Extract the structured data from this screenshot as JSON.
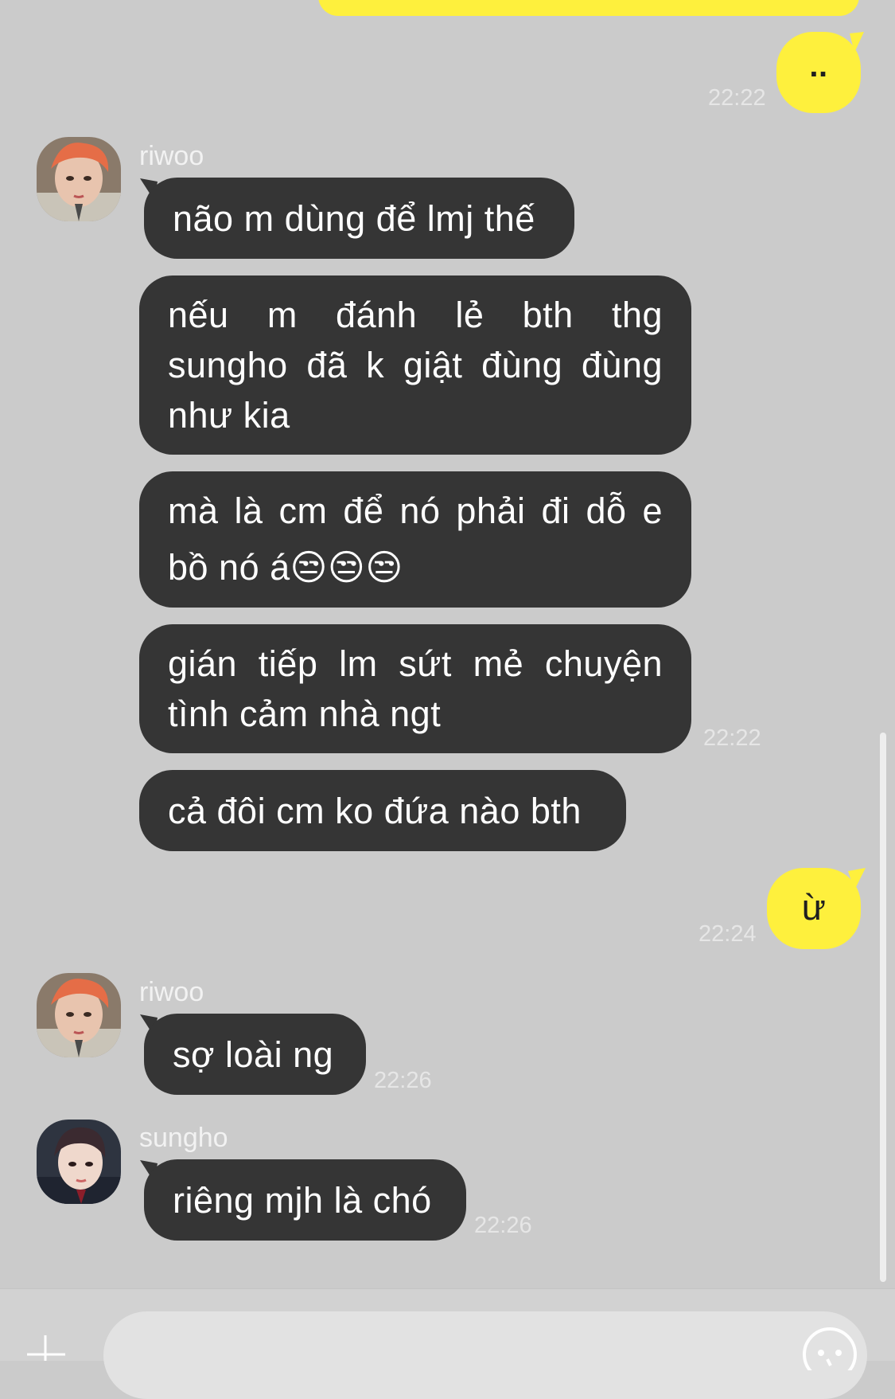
{
  "messages": {
    "m1_text": "..",
    "m1_time": "22:22",
    "group1_sender": "riwoo",
    "g1_b1": "não m dùng để lmj thế",
    "g1_b2_l1": "nếu m đánh lẻ bth thg",
    "g1_b2_l2": "sungho đã k giật đùng đùng",
    "g1_b2_l3": "như kia",
    "g1_b3_l1": "mà là cm để nó phải đi dỗ e",
    "g1_b3_l2": "bồ nó á😒😒😒",
    "g1_b4_l1": "gián tiếp lm sứt mẻ chuyện",
    "g1_b4_l2": "tình cảm nhà ngt",
    "g1_b4_time": "22:22",
    "g1_b5": "cả đôi cm ko đứa nào bth",
    "m2_text": "ừ",
    "m2_time": "22:24",
    "group2_sender": "riwoo",
    "g2_b1": "sợ loài ng",
    "g2_time": "22:26",
    "group3_sender": "sungho",
    "g3_b1": "riêng mjh là chó",
    "g3_time": "22:26"
  },
  "colors": {
    "background": "#cbcbcb",
    "my_bubble": "#fef03d",
    "their_bubble": "#353535"
  },
  "icons": {
    "plus": "plus-icon",
    "emoji": "emoji-icon"
  }
}
